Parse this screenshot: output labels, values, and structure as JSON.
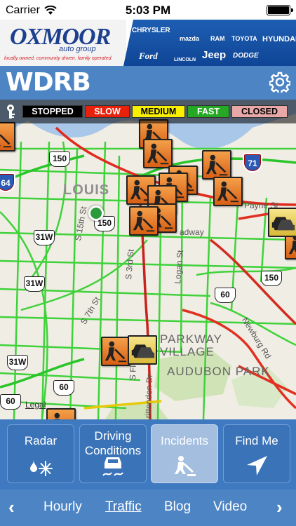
{
  "status_bar": {
    "carrier": "Carrier",
    "time": "5:03 PM"
  },
  "ad": {
    "logo": "OXMOOR",
    "sub": "auto group",
    "tagline": "locally owned. community driven. family operated.",
    "brands": [
      "CHRYSLER",
      "mazda",
      "RAM",
      "TOYOTA",
      "HYUNDAI",
      "Ford",
      "LINCOLN",
      "Jeep",
      "DODGE"
    ]
  },
  "header": {
    "title": "WDRB",
    "settings_icon": "gear-icon"
  },
  "legend": {
    "items": [
      {
        "label": "STOPPED",
        "bg": "#000000",
        "fg": "#ffffff",
        "width": 86
      },
      {
        "label": "SLOW",
        "bg": "#e8210c",
        "fg": "#ffffff",
        "width": 64
      },
      {
        "label": "MEDIUM",
        "bg": "#f8f000",
        "fg": "#000000",
        "width": 76
      },
      {
        "label": "FAST",
        "bg": "#27a825",
        "fg": "#ffffff",
        "width": 60
      },
      {
        "label": "CLOSED",
        "bg": "#e8a8a8",
        "fg": "#000000",
        "width": 80
      }
    ]
  },
  "map": {
    "city_label": "LOUIS",
    "neighborhoods": [
      "PARKWAY",
      "VILLAGE",
      "AUDUBON PARK"
    ],
    "streets": [
      "S 15th St",
      "S 3rd St",
      "S 7th St",
      "Logan St",
      "Payne St",
      "Newburg Rd",
      "adway",
      "S Flo",
      "rittenden Dr"
    ],
    "routes": [
      "150",
      "150",
      "150",
      "31W",
      "31W",
      "31W",
      "60",
      "60",
      "60"
    ],
    "interstates": [
      "64",
      "71"
    ],
    "legal": "Legal"
  },
  "tabs": [
    {
      "label_1": "Radar",
      "label_2": "",
      "icon": "rain-snow-icon"
    },
    {
      "label_1": "Driving",
      "label_2": "Conditions",
      "icon": "slippery-road-icon"
    },
    {
      "label_1": "Incidents",
      "label_2": "",
      "icon": "road-work-icon",
      "active": true
    },
    {
      "label_1": "Find Me",
      "label_2": "",
      "icon": "location-arrow-icon"
    }
  ],
  "bottom_nav": {
    "prev": "‹",
    "next": "›",
    "items": [
      "Hourly",
      "Traffic",
      "Blog",
      "Video"
    ],
    "current": "Traffic"
  }
}
